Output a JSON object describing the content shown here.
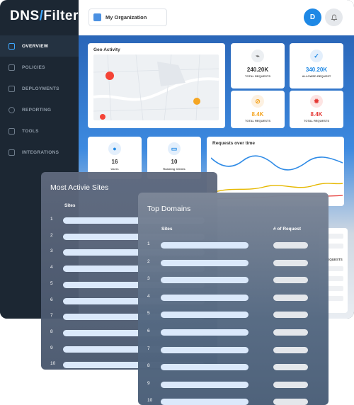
{
  "brand": {
    "logo_text": "DNS",
    "logo_suffix": "Filter",
    "accent": "#1e88e5"
  },
  "header": {
    "org_label": "My Organization",
    "avatar_initial": "D"
  },
  "sidebar": {
    "items": [
      {
        "label": "OVERVIEW",
        "icon": "grid-icon",
        "active": true
      },
      {
        "label": "POLICIES",
        "icon": "shield-icon",
        "active": false
      },
      {
        "label": "DEPLOYMENTS",
        "icon": "laptop-icon",
        "active": false
      },
      {
        "label": "REPORTING",
        "icon": "pie-chart-icon",
        "active": false
      },
      {
        "label": "TOOLS",
        "icon": "tools-icon",
        "active": false
      },
      {
        "label": "INTEGRATIONS",
        "icon": "plug-icon",
        "active": false
      }
    ]
  },
  "geo": {
    "title": "Geo Activity"
  },
  "stats": {
    "total_requests": {
      "value": "240.20K",
      "label": "TOTAL REQUESTS",
      "icon": "signal-icon",
      "color": "#333333"
    },
    "allowed_requests": {
      "value": "340.20K",
      "label": "ALLOWED REQUEST",
      "icon": "check-icon",
      "color": "#1e88e5"
    },
    "total_requests_warn": {
      "value": "8.4K",
      "label": "TOTAL REQUESTS",
      "icon": "block-icon",
      "color": "#f5a623"
    },
    "total_requests_threat": {
      "value": "8.4K",
      "label": "TOTAL REQUESTS",
      "icon": "virus-icon",
      "color": "#e53935"
    }
  },
  "users": {
    "value": "16",
    "label": "Users"
  },
  "roaming": {
    "value": "10",
    "label": "Roaming Clients"
  },
  "requests_chart": {
    "title": "Requests over time"
  },
  "most_active": {
    "title": "Most Activie Sites",
    "col_sites": "Sites",
    "rows": [
      "1",
      "2",
      "3",
      "4",
      "5",
      "6",
      "7",
      "8",
      "9",
      "10"
    ]
  },
  "top_domains": {
    "title": "Top Domains",
    "col_sites": "Sites",
    "col_requests": "# of Request",
    "rows": [
      "1",
      "2",
      "3",
      "4",
      "5",
      "6",
      "7",
      "8",
      "9",
      "10"
    ]
  },
  "partial_label": "REQUESTS"
}
